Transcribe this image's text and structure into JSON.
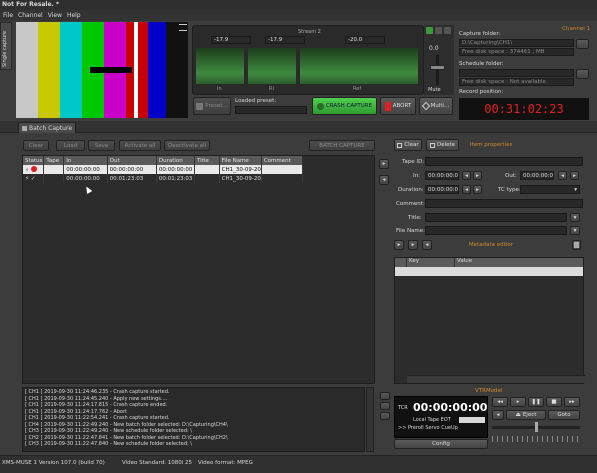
{
  "window": {
    "title": "Not For Resale. *"
  },
  "menu": [
    "File",
    "Channel",
    "View",
    "Help"
  ],
  "side_tab": "Single capture",
  "channel_label": "Channel 1",
  "meters": {
    "db_labels": [
      "-17.9",
      "-17.9",
      "-20.0"
    ],
    "stream_label": "Stream 2",
    "scale_labels": [
      "In",
      "Ri",
      "Ref"
    ],
    "volume_value": "0.0",
    "mute_label": "Mute"
  },
  "capture_folder": {
    "label": "Capture folder:",
    "path": "D:\\Capturing\\CH1\\",
    "free_space": "Free disk space : 374461 , MB"
  },
  "schedule_folder": {
    "label": "Schedule folder:",
    "free_space": "Free disk space : Not available"
  },
  "record_position": {
    "label": "Record position:",
    "value": "00:31:02:23"
  },
  "preset": {
    "button_label": "Preset...",
    "loaded_label": "Loaded preset:",
    "crash_label": "CRASH CAPTURE",
    "abort_label": "ABORT",
    "multi_label": "Multi..."
  },
  "tab": "Batch Capture",
  "batch_toolbar": [
    "Clear",
    "Load",
    "Save",
    "Activate all",
    "Deactivate all"
  ],
  "batch_capture_label": "BATCH CAPTURE",
  "table": {
    "columns": [
      "Status",
      "Tape",
      "In",
      "Out",
      "Duration",
      "Title",
      "File Name",
      "Comment"
    ],
    "rows": [
      {
        "tape": "",
        "in": "00:00:00:00",
        "out": "00:00:00:00",
        "duration": "00:00:00:00",
        "title": "",
        "file": "CH1_30-09-20",
        "comment": ""
      },
      {
        "tape": "",
        "in": "00:00:00:00",
        "out": "00:01:23:03",
        "duration": "00:01:23:03",
        "title": "",
        "file": "CH1_30-09-20",
        "comment": ""
      }
    ]
  },
  "item_props": {
    "clear_label": "Clear",
    "delete_label": "Delete",
    "header": "Item properties",
    "tape_id_label": "Tape ID:",
    "in_label": "In:",
    "in_value": "00:00:00:00",
    "out_label": "Out:",
    "out_value": "00:00:00:00",
    "duration_label": "Duration:",
    "duration_value": "00:00:00:00",
    "tc_type_label": "TC type:",
    "comment_label": "Comment:",
    "title_label": "Title:",
    "filename_label": "File Name:"
  },
  "metadata": {
    "header": "Metadata editor",
    "col_key": "Key",
    "col_value": "Value"
  },
  "log": [
    "[ CH1 ] 2019-09-30 11:24:46.235 - Crash capture started.",
    "[ CH1 ] 2019-09-30 11:24:45.240 - Apply new settings....",
    "[ CH1 ] 2019-09-30 11:24:17.815 - Crash capture ended.",
    "[ CH1 ] 2019-09-30 11:24:17.762 - Abort",
    "[ CH1 ] 2019-09-30 11:22:54.241 - Crash capture started.",
    "[ CH4 ] 2019-09-30 11:22:49.240 - New batch folder selected: D:\\Capturing\\CH4\\",
    "[ CH3 ] 2019-09-30 11:22:49.240 - New schedule folder selected: \\",
    "[ CH2 ] 2019-09-30 11:22:47.841 - New batch folder selected: D:\\Capturing\\CH2\\",
    "[ CH3 ] 2019-09-30 11:22:47.840 - New schedule folder selected: \\"
  ],
  "vtr": {
    "title": "VTRModel",
    "tcr_label": "TCR",
    "timecode": "00:00:00:00",
    "line1": "Local  Tape  EOT",
    "line2": ">> Preroll  Servo  CueUp",
    "config_label": "Config",
    "eject_label": "Eject",
    "goto_label": "Goto"
  },
  "status_bar": {
    "version": "XMS-MUSE 1  Version 107.0 (build 70)",
    "video_standard": "Video Standard: 1080i 25",
    "video_format": "Video format: MPEG"
  },
  "colors": {
    "accent": "#d08a2a",
    "record": "#e02020",
    "crash": "#3fbf3f"
  }
}
